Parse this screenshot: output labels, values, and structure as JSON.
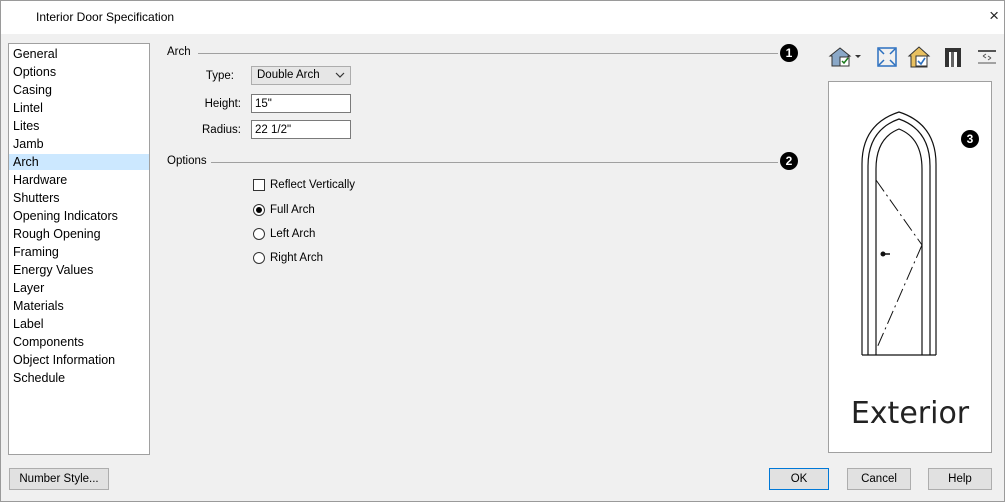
{
  "window": {
    "title": "Interior Door Specification",
    "close_glyph": "×"
  },
  "nav": {
    "selected": "Arch",
    "items": [
      "General",
      "Options",
      "Casing",
      "Lintel",
      "Lites",
      "Jamb",
      "Arch",
      "Hardware",
      "Shutters",
      "Opening Indicators",
      "Rough Opening",
      "Framing",
      "Energy Values",
      "Layer",
      "Materials",
      "Label",
      "Components",
      "Object Information",
      "Schedule"
    ]
  },
  "arch": {
    "group_label": "Arch",
    "callout": "1",
    "type_label": "Type:",
    "type_value": "Double Arch",
    "height_label": "Height:",
    "height_value": "15\"",
    "radius_label": "Radius:",
    "radius_value": "22 1/2\""
  },
  "options": {
    "group_label": "Options",
    "callout": "2",
    "reflect_vertically": {
      "label": "Reflect Vertically",
      "checked": false
    },
    "radios": [
      {
        "label": "Full Arch",
        "selected": true
      },
      {
        "label": "Left Arch",
        "selected": false
      },
      {
        "label": "Right Arch",
        "selected": false
      }
    ]
  },
  "preview": {
    "callout": "3",
    "label": "Exterior"
  },
  "toolbar": {
    "icons": [
      "camera-view-dropdown-icon",
      "fill-window-icon",
      "preview-exterior-icon",
      "door-jamb-icon",
      "swap-sides-icon"
    ]
  },
  "buttons": {
    "number_style": "Number Style...",
    "ok": "OK",
    "cancel": "Cancel",
    "help": "Help"
  },
  "colors": {
    "selection": "#cce8ff",
    "accent": "#0078d7"
  }
}
